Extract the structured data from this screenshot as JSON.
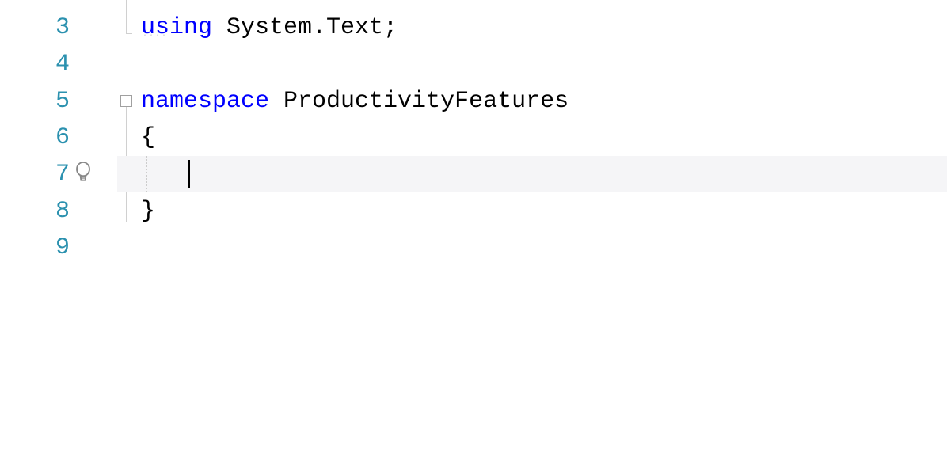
{
  "lines": {
    "n3": "3",
    "n4": "4",
    "n5": "5",
    "n6": "6",
    "n7": "7",
    "n8": "8",
    "n9": "9"
  },
  "code": {
    "line3_kw": "using",
    "line3_txt": " System.Text;",
    "line5_kw": "namespace",
    "line5_txt": " ProductivityFeatures",
    "line6_txt": "{",
    "line8_txt": "}"
  },
  "layout": {
    "line_top_3": -12,
    "line_top_4": 58,
    "line_top_5": 105,
    "line_top_6": 151,
    "line_top_7": 197,
    "line_top_8": 244,
    "line_top_9": 290
  }
}
